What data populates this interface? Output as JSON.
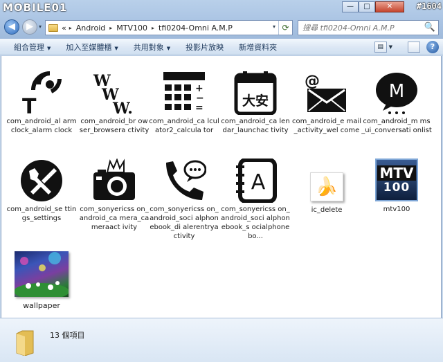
{
  "watermark": {
    "site": "MOBILE01",
    "post_id": "#1604"
  },
  "window": {
    "minimize": "—",
    "maximize": "□",
    "close": "✕"
  },
  "nav": {
    "back": "◀",
    "forward": "▶",
    "dropdown": "▾"
  },
  "address": {
    "prefix": "«",
    "crumbs": [
      "Android",
      "MTV100",
      "tfi0204-Omni A.M.P"
    ],
    "separator": "▸",
    "dropdown": "▾",
    "refresh": "⟳"
  },
  "search": {
    "placeholder": "搜尋 tfi0204-Omni A.M.P",
    "icon": "🔍"
  },
  "toolbar": {
    "items": [
      {
        "label": "組合管理",
        "has_menu": true
      },
      {
        "label": "加入至媒體櫃",
        "has_menu": true
      },
      {
        "label": "共用對象",
        "has_menu": true
      },
      {
        "label": "投影片放映",
        "has_menu": false
      },
      {
        "label": "新增資料夾",
        "has_menu": false
      }
    ],
    "menu_arrow": "▼",
    "view_icon": "▤",
    "help": "?"
  },
  "files": [
    {
      "name": "com_android_alarmclock_alarmclock",
      "label": "com_android_al armclock_alarm clock",
      "icon": "alarm-icon"
    },
    {
      "name": "com_android_browser_browseractivity",
      "label": "com_android_br owser_browsera ctivity",
      "icon": "browser-icon",
      "glyph": "WWW."
    },
    {
      "name": "com_android_calculator2_calculator",
      "label": "com_android_ca lculator2_calcula tor",
      "icon": "calculator-icon"
    },
    {
      "name": "com_android_calendar_launchactivity",
      "label": "com_android_ca lendar_launchac tivity",
      "icon": "calendar-icon",
      "glyph": "大安"
    },
    {
      "name": "com_android_email_activity_welcome",
      "label": "com_android_e mail_activity_wel come",
      "icon": "email-icon",
      "glyph": "@"
    },
    {
      "name": "com_android_mms_ui_conversationlist",
      "label": "com_android_m ms_ui_conversati onlist",
      "icon": "mms-icon",
      "glyph": "M"
    },
    {
      "name": "com_android_settings_settings",
      "label": "com_android_se ttings_settings",
      "icon": "settings-icon"
    },
    {
      "name": "com_sonyericsson_android_camera_cameraactivity",
      "label": "com_sonyericss on_android_ca mera_cameraact ivity",
      "icon": "camera-icon"
    },
    {
      "name": "com_sonyericsson_android_socialphonebook_dialerentryactivity",
      "label": "com_sonyericss on_android_soci alphonebook_di alerentryactivity",
      "icon": "dialer-icon"
    },
    {
      "name": "com_sonyericsson_android_socialphonebook_socialphonebo",
      "label": "com_sonyericss on_android_soci alphonebook_s ocialphonebo...",
      "icon": "phonebook-icon",
      "glyph": "A"
    },
    {
      "name": "ic_delete",
      "label": "ic_delete",
      "icon": "banana-icon",
      "glyph": "🍌"
    },
    {
      "name": "mtv100",
      "label": "mtv100",
      "icon": "mtv-logo-icon",
      "glyph": "MTV",
      "glyph2": "100"
    },
    {
      "name": "wallpaper",
      "label": "wallpaper",
      "icon": "wallpaper-image"
    }
  ],
  "status": {
    "count": "13 個項目"
  },
  "colors": {
    "accent": "#2f6bbd",
    "toolbar": "#dde8f5",
    "icon": "#111111"
  }
}
